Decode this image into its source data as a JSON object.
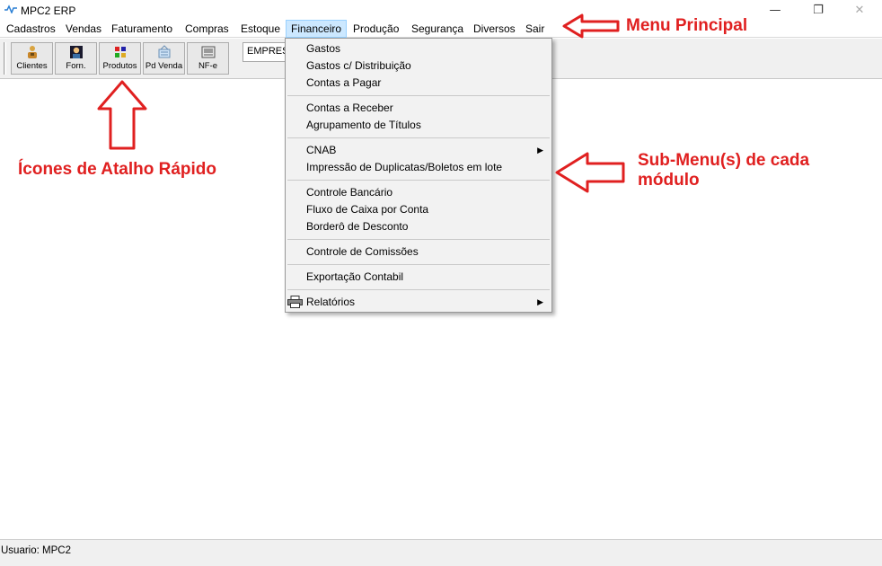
{
  "window": {
    "title": "MPC2 ERP",
    "controls": {
      "minimize": "—",
      "maximize": "❐",
      "close": "✕"
    }
  },
  "menu": {
    "items": [
      "Cadastros",
      "Vendas",
      "Faturamento",
      "Compras",
      "Estoque",
      "Financeiro",
      "Produção",
      "Segurança",
      "Diversos",
      "Sair"
    ],
    "active": "Financeiro"
  },
  "toolbar": {
    "buttons": [
      {
        "label": "Clientes",
        "icon": "clients-icon"
      },
      {
        "label": "Forn.",
        "icon": "supplier-icon"
      },
      {
        "label": "Produtos",
        "icon": "products-icon"
      },
      {
        "label": "Pd Venda",
        "icon": "sales-order-icon"
      },
      {
        "label": "NF-e",
        "icon": "nfe-icon"
      }
    ],
    "company_field": "EMPRESA"
  },
  "submenu": {
    "groups": [
      [
        "Gastos",
        "Gastos c/ Distribuição",
        "Contas a Pagar"
      ],
      [
        "Contas a Receber",
        "Agrupamento de Títulos"
      ],
      [
        "CNAB",
        "Impressão de Duplicatas/Boletos em lote"
      ],
      [
        "Controle Bancário",
        "Fluxo de Caixa por Conta",
        "Borderô de Desconto"
      ],
      [
        "Controle de Comissões"
      ],
      [
        "Exportação Contabil"
      ],
      [
        "Relatórios"
      ]
    ],
    "has_submenu": [
      "CNAB",
      "Relatórios"
    ]
  },
  "annotations": {
    "menu_principal": "Menu Principal",
    "icones_atalho": "Ícones de Atalho Rápido",
    "submenu_line1": "Sub-Menu(s) de cada",
    "submenu_line2": "módulo",
    "color": "#e02020"
  },
  "status": {
    "text": "Usuario: MPC2"
  }
}
